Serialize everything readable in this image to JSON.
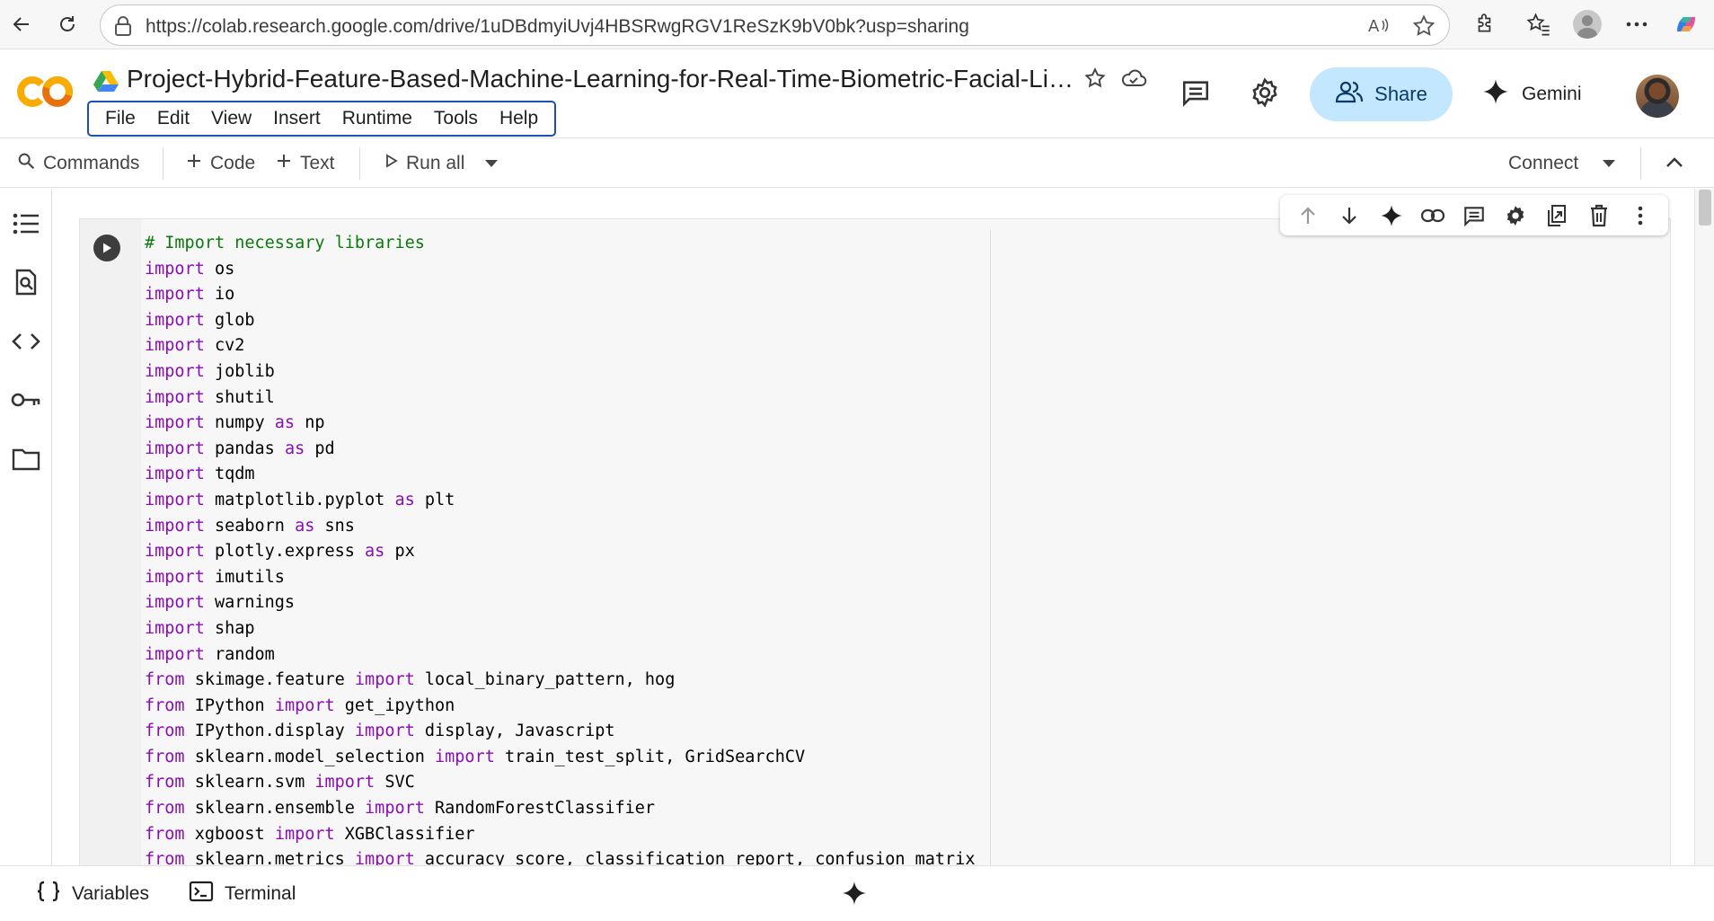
{
  "browser": {
    "url": "https://colab.research.google.com/drive/1uDBdmyiUvj4HBSRwgRGV1ReSzK9bV0bk?usp=sharing"
  },
  "header": {
    "logo_text": "CO",
    "title": "Project-Hybrid-Feature-Based-Machine-Learning-for-Real-Time-Biometric-Facial-Liv...",
    "menu": [
      "File",
      "Edit",
      "View",
      "Insert",
      "Runtime",
      "Tools",
      "Help"
    ],
    "share_label": "Share",
    "gemini_label": "Gemini"
  },
  "toolbar": {
    "commands_label": "Commands",
    "code_label": "Code",
    "text_label": "Text",
    "run_all_label": "Run all",
    "connect_label": "Connect"
  },
  "cell": {
    "lines": [
      [
        [
          "cm",
          "# Import necessary libraries"
        ]
      ],
      [
        [
          "kw",
          "import"
        ],
        [
          "",
          " os"
        ]
      ],
      [
        [
          "kw",
          "import"
        ],
        [
          "",
          " io"
        ]
      ],
      [
        [
          "kw",
          "import"
        ],
        [
          "",
          " glob"
        ]
      ],
      [
        [
          "kw",
          "import"
        ],
        [
          "",
          " cv2"
        ]
      ],
      [
        [
          "kw",
          "import"
        ],
        [
          "",
          " joblib"
        ]
      ],
      [
        [
          "kw",
          "import"
        ],
        [
          "",
          " shutil"
        ]
      ],
      [
        [
          "kw",
          "import"
        ],
        [
          "",
          " numpy "
        ],
        [
          "kw",
          "as"
        ],
        [
          "",
          " np"
        ]
      ],
      [
        [
          "kw",
          "import"
        ],
        [
          "",
          " pandas "
        ],
        [
          "kw",
          "as"
        ],
        [
          "",
          " pd"
        ]
      ],
      [
        [
          "kw",
          "import"
        ],
        [
          "",
          " tqdm"
        ]
      ],
      [
        [
          "kw",
          "import"
        ],
        [
          "",
          " matplotlib.pyplot "
        ],
        [
          "kw",
          "as"
        ],
        [
          "",
          " plt"
        ]
      ],
      [
        [
          "kw",
          "import"
        ],
        [
          "",
          " seaborn "
        ],
        [
          "kw",
          "as"
        ],
        [
          "",
          " sns"
        ]
      ],
      [
        [
          "kw",
          "import"
        ],
        [
          "",
          " plotly.express "
        ],
        [
          "kw",
          "as"
        ],
        [
          "",
          " px"
        ]
      ],
      [
        [
          "kw",
          "import"
        ],
        [
          "",
          " imutils"
        ]
      ],
      [
        [
          "kw",
          "import"
        ],
        [
          "",
          " warnings"
        ]
      ],
      [
        [
          "kw",
          "import"
        ],
        [
          "",
          " shap"
        ]
      ],
      [
        [
          "kw",
          "import"
        ],
        [
          "",
          " random"
        ]
      ],
      [
        [
          "kw",
          "from"
        ],
        [
          "",
          " skimage.feature "
        ],
        [
          "kw",
          "import"
        ],
        [
          "",
          " local_binary_pattern, hog"
        ]
      ],
      [
        [
          "kw",
          "from"
        ],
        [
          "",
          " IPython "
        ],
        [
          "kw",
          "import"
        ],
        [
          "",
          " get_ipython"
        ]
      ],
      [
        [
          "kw",
          "from"
        ],
        [
          "",
          " IPython.display "
        ],
        [
          "kw",
          "import"
        ],
        [
          "",
          " display, Javascript"
        ]
      ],
      [
        [
          "kw",
          "from"
        ],
        [
          "",
          " sklearn.model_selection "
        ],
        [
          "kw",
          "import"
        ],
        [
          "",
          " train_test_split, GridSearchCV"
        ]
      ],
      [
        [
          "kw",
          "from"
        ],
        [
          "",
          " sklearn.svm "
        ],
        [
          "kw",
          "import"
        ],
        [
          "",
          " SVC"
        ]
      ],
      [
        [
          "kw",
          "from"
        ],
        [
          "",
          " sklearn.ensemble "
        ],
        [
          "kw",
          "import"
        ],
        [
          "",
          " RandomForestClassifier"
        ]
      ],
      [
        [
          "kw",
          "from"
        ],
        [
          "",
          " xgboost "
        ],
        [
          "kw",
          "import"
        ],
        [
          "",
          " XGBClassifier"
        ]
      ],
      [
        [
          "kw",
          "from"
        ],
        [
          "",
          " sklearn.metrics "
        ],
        [
          "kw",
          "import"
        ],
        [
          "",
          " accuracy_score, classification_report, confusion_matrix"
        ]
      ]
    ]
  },
  "bottom": {
    "variables_label": "Variables",
    "terminal_label": "Terminal"
  },
  "colors": {
    "keyword": "#8a0eb5",
    "comment": "#0b7a0b",
    "share_bg": "#c2e7ff",
    "logo_orange": "#f9ab00"
  }
}
